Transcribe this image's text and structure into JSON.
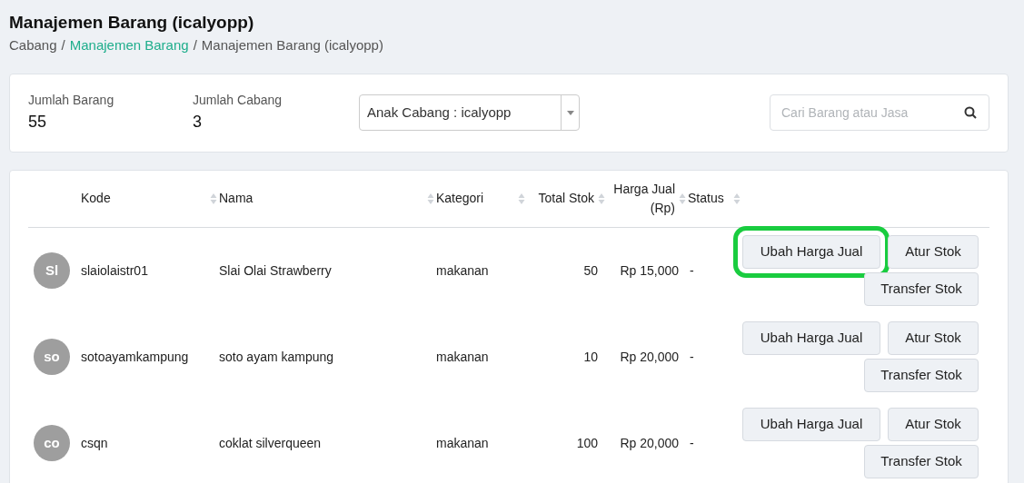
{
  "title": "Manajemen Barang (icalyopp)",
  "breadcrumb_separator": "/",
  "breadcrumb": [
    {
      "label": "Cabang",
      "link": false
    },
    {
      "label": "Manajemen Barang",
      "link": true
    },
    {
      "label": "Manajemen Barang (icalyopp)",
      "link": false
    }
  ],
  "stats": [
    {
      "label": "Jumlah Barang",
      "value": "55"
    },
    {
      "label": "Jumlah Cabang",
      "value": "3"
    }
  ],
  "branch_select": {
    "value": "Anak Cabang : icalyopp"
  },
  "search": {
    "placeholder": "Cari Barang atau Jasa"
  },
  "table": {
    "columns": [
      {
        "label": "Kode"
      },
      {
        "label": "Nama"
      },
      {
        "label": "Kategori"
      },
      {
        "label": "Total Stok"
      },
      {
        "label": "Harga Jual (Rp)"
      },
      {
        "label": "Status"
      }
    ],
    "rows": [
      {
        "initials": "Sl",
        "kode": "slaiolaistr01",
        "nama": "Slai Olai Strawberry",
        "kategori": "makanan",
        "stok": "50",
        "harga": "Rp 15,000",
        "status": "-",
        "actions": [
          {
            "label": "Ubah Harga Jual",
            "highlighted": true
          },
          {
            "label": "Atur Stok",
            "highlighted": false
          },
          {
            "label": "Transfer Stok",
            "highlighted": false
          }
        ]
      },
      {
        "initials": "so",
        "kode": "sotoayamkampung",
        "nama": "soto ayam kampung",
        "kategori": "makanan",
        "stok": "10",
        "harga": "Rp 20,000",
        "status": "-",
        "actions": [
          {
            "label": "Ubah Harga Jual",
            "highlighted": false
          },
          {
            "label": "Atur Stok",
            "highlighted": false
          },
          {
            "label": "Transfer Stok",
            "highlighted": false
          }
        ]
      },
      {
        "initials": "co",
        "kode": "csqn",
        "nama": "coklat silverqueen",
        "kategori": "makanan",
        "stok": "100",
        "harga": "Rp 20,000",
        "status": "-",
        "actions": [
          {
            "label": "Ubah Harga Jual",
            "highlighted": false
          },
          {
            "label": "Atur Stok",
            "highlighted": false
          },
          {
            "label": "Transfer Stok",
            "highlighted": false
          }
        ]
      }
    ]
  }
}
